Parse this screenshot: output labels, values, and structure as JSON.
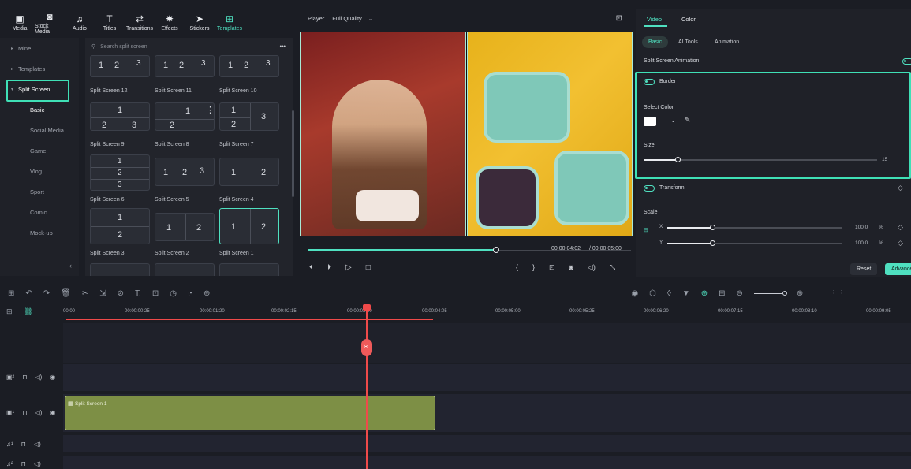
{
  "toolbar": {
    "items": [
      {
        "label": "Media",
        "icon": "media-icon"
      },
      {
        "label": "Stock Media",
        "icon": "stock-media-icon"
      },
      {
        "label": "Audio",
        "icon": "audio-icon"
      },
      {
        "label": "Titles",
        "icon": "titles-icon"
      },
      {
        "label": "Transitions",
        "icon": "transitions-icon"
      },
      {
        "label": "Effects",
        "icon": "effects-icon"
      },
      {
        "label": "Stickers",
        "icon": "stickers-icon"
      },
      {
        "label": "Templates",
        "icon": "templates-icon"
      }
    ]
  },
  "sidebar": {
    "items": [
      {
        "label": "Mine"
      },
      {
        "label": "Templates"
      },
      {
        "label": "Split Screen"
      },
      {
        "label": "Basic"
      },
      {
        "label": "Social Media"
      },
      {
        "label": "Game"
      },
      {
        "label": "Vlog"
      },
      {
        "label": "Sport"
      },
      {
        "label": "Comic"
      },
      {
        "label": "Mock-up"
      }
    ]
  },
  "templates": {
    "search_placeholder": "Search split screen",
    "more": "•••",
    "cards": [
      {
        "label": "Split Screen 12"
      },
      {
        "label": "Split Screen 11"
      },
      {
        "label": "Split Screen 10"
      },
      {
        "label": "Split Screen 9"
      },
      {
        "label": "Split Screen 8"
      },
      {
        "label": "Split Screen 7"
      },
      {
        "label": "Split Screen 6"
      },
      {
        "label": "Split Screen 5"
      },
      {
        "label": "Split Screen 4"
      },
      {
        "label": "Split Screen 3"
      },
      {
        "label": "Split Screen 2"
      },
      {
        "label": "Split Screen 1"
      }
    ]
  },
  "player": {
    "label": "Player",
    "quality": "Full Quality",
    "current_time": "00:00:04:02",
    "total_time": "/ 00:00:05:00",
    "progress": 0.58
  },
  "panel": {
    "tabs": [
      "Video",
      "Color"
    ],
    "subtabs": [
      "Basic",
      "AI Tools",
      "Animation"
    ],
    "split_screen_animation": "Split Screen Animation",
    "border": "Border",
    "select_color": "Select Color",
    "size": "Size",
    "size_value": "15",
    "transform": "Transform",
    "scale": "Scale",
    "x_label": "X",
    "y_label": "Y",
    "x_value": "100.0",
    "y_value": "100.0",
    "unit": "%",
    "reset": "Reset",
    "advanced": "Advance"
  },
  "timeline": {
    "ruler": [
      "00:00",
      "00:00:00:25",
      "00:00:01:20",
      "00:00:02:15",
      "00:00:03:10",
      "00:00:04:05",
      "00:00:05:00",
      "00:00:05:25",
      "00:00:06:20",
      "00:00:07:15",
      "00:00:08:10",
      "00:00:09:05"
    ],
    "clip_label": "Split Screen 1"
  },
  "colors": {
    "accent": "#4fe0c0",
    "playhead": "#ef4a4a",
    "clip": "#7d8f45"
  }
}
